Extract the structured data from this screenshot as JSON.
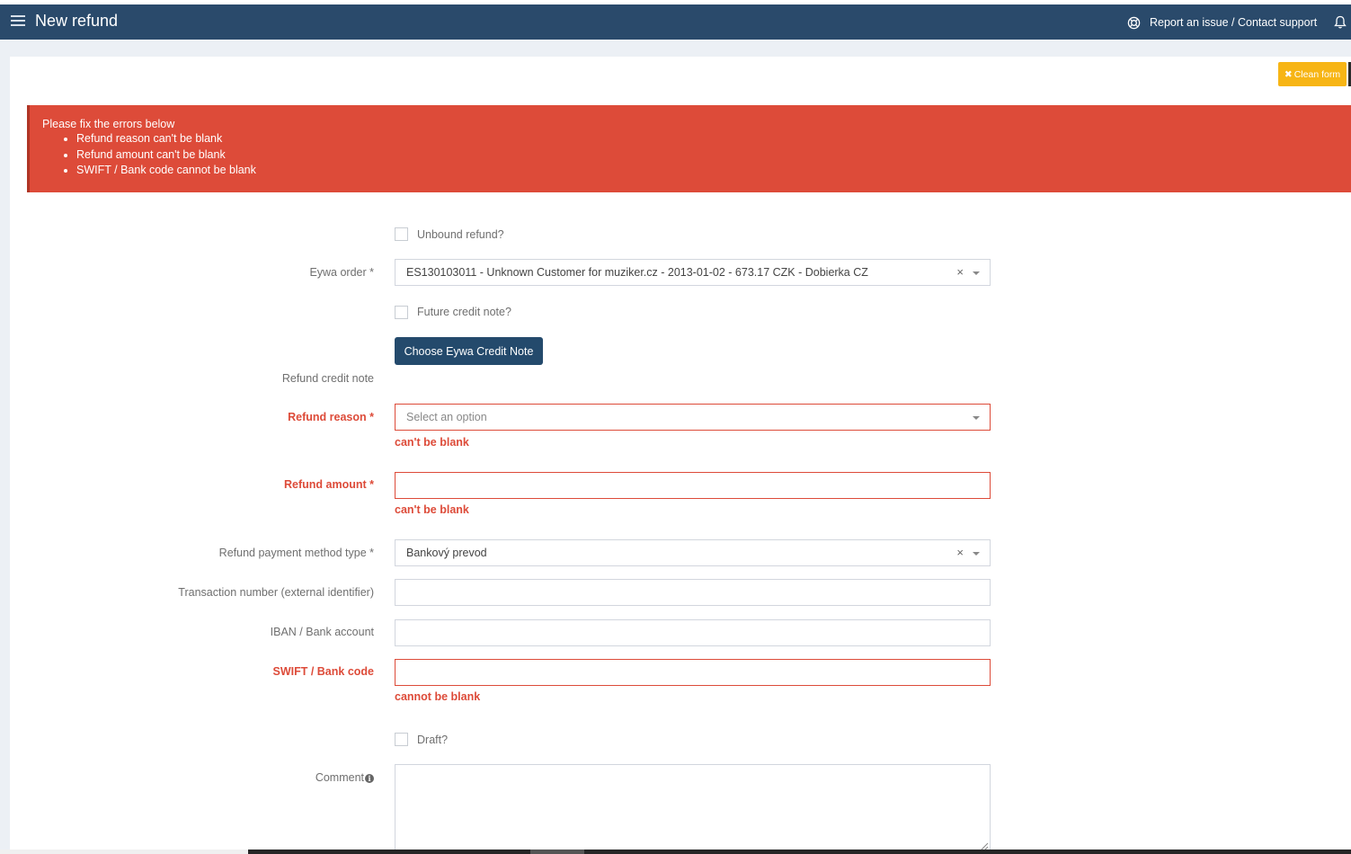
{
  "header": {
    "title": "New refund",
    "support_link": "Report an issue / Contact support",
    "icons": {
      "menu": "hamburger-menu-icon",
      "support": "lifebuoy-icon",
      "notifications": "bell-icon"
    }
  },
  "toolbar": {
    "clean_form_label": "Clean form",
    "clean_form_icon": "✖"
  },
  "alert": {
    "heading": "Please fix the errors below",
    "errors": [
      "Refund reason can't be blank",
      "Refund amount can't be blank",
      "SWIFT / Bank code cannot be blank"
    ]
  },
  "form": {
    "unbound_refund": {
      "label": "Unbound refund?",
      "checked": false
    },
    "eywa_order": {
      "label": "Eywa order *",
      "value": "ES130103011 - Unknown Customer for muziker.cz - 2013-01-02 - 673.17 CZK - Dobierka CZ",
      "clear": "×"
    },
    "future_credit_note": {
      "label": "Future credit note?",
      "checked": false
    },
    "choose_credit_note_button": "Choose Eywa Credit Note",
    "refund_credit_note": {
      "label": "Refund credit note"
    },
    "refund_reason": {
      "label": "Refund reason *",
      "placeholder": "Select an option",
      "error": "can't be blank"
    },
    "refund_amount": {
      "label": "Refund amount *",
      "value": "",
      "error": "can't be blank"
    },
    "payment_method_type": {
      "label": "Refund payment method type *",
      "value": "Bankový prevod",
      "clear": "×"
    },
    "transaction_number": {
      "label": "Transaction number (external identifier)",
      "value": ""
    },
    "iban": {
      "label": "IBAN / Bank account",
      "value": ""
    },
    "swift": {
      "label": "SWIFT / Bank code",
      "value": "",
      "error": "cannot be blank"
    },
    "draft": {
      "label": "Draft?",
      "checked": false
    },
    "comment": {
      "label": "Comment",
      "value": ""
    }
  },
  "colors": {
    "header_bg": "#2a4a6b",
    "error": "#dd4b39",
    "warning_button": "#f7b515",
    "primary_button": "#244a6c"
  }
}
